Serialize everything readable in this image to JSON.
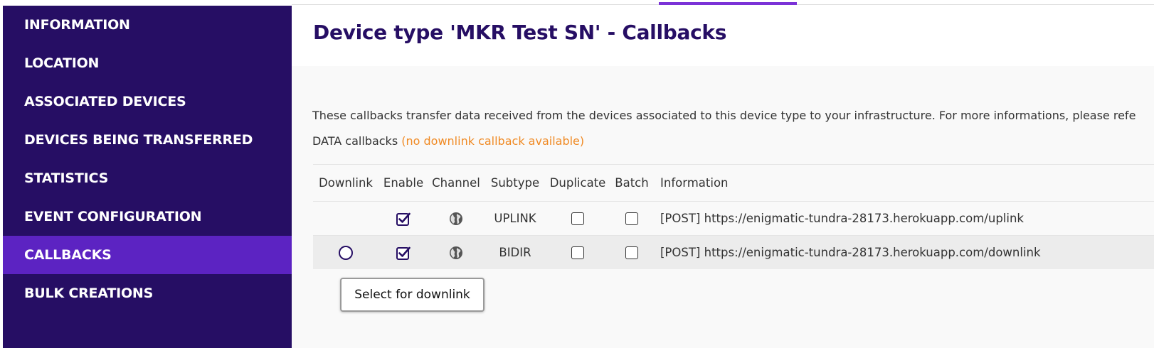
{
  "sidebar": {
    "items": [
      {
        "label": "INFORMATION"
      },
      {
        "label": "LOCATION"
      },
      {
        "label": "ASSOCIATED DEVICES"
      },
      {
        "label": "DEVICES BEING TRANSFERRED"
      },
      {
        "label": "STATISTICS"
      },
      {
        "label": "EVENT CONFIGURATION"
      },
      {
        "label": "CALLBACKS",
        "active": true
      },
      {
        "label": "BULK CREATIONS"
      }
    ]
  },
  "header": {
    "title": "Device type 'MKR Test SN' - Callbacks"
  },
  "main": {
    "description": "These callbacks transfer data received from the devices associated to this device type to your infrastructure. For more informations, please refe",
    "callbacks_title": "DATA callbacks",
    "callbacks_note": "(no downlink callback available)",
    "table": {
      "headers": [
        "Downlink",
        "Enable",
        "Channel",
        "Subtype",
        "Duplicate",
        "Batch",
        "Information"
      ],
      "rows": [
        {
          "downlink_selectable": false,
          "enabled": true,
          "channel_icon": "globe-icon",
          "subtype": "UPLINK",
          "duplicate": false,
          "batch": false,
          "information": "[POST] https://enigmatic-tundra-28173.herokuapp.com/uplink"
        },
        {
          "downlink_selectable": true,
          "downlink_selected": false,
          "enabled": true,
          "channel_icon": "globe-icon",
          "subtype": "BIDIR",
          "duplicate": false,
          "batch": false,
          "information": "[POST] https://enigmatic-tundra-28173.herokuapp.com/downlink"
        }
      ]
    },
    "tooltip": "Select for downlink"
  },
  "colors": {
    "sidebar_bg": "#260e64",
    "sidebar_active": "#5c23c2",
    "title": "#260e64",
    "accent": "#7b32d7",
    "note": "#f08a24"
  }
}
